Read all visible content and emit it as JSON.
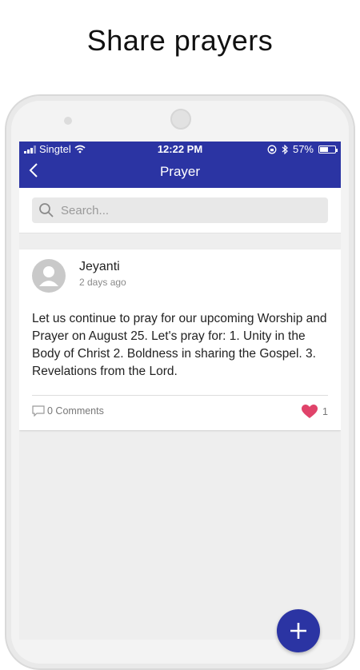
{
  "headline": "Share prayers",
  "status_bar": {
    "carrier": "Singtel",
    "time": "12:22 PM",
    "battery_percent": "57%",
    "battery_level": 0.57
  },
  "app_bar": {
    "title": "Prayer",
    "back_icon": "chevron-left-icon",
    "color": "#2b34a3"
  },
  "search": {
    "placeholder": "Search...",
    "value": ""
  },
  "post": {
    "author": "Jeyanti",
    "posted": "2 days ago",
    "body": "Let us continue to pray for our upcoming Worship and Prayer on August 25. Let's pray for: 1. Unity in the Body of Christ 2. Boldness in sharing the Gospel. 3. Revelations from the Lord.",
    "comments_label": "0 Comments",
    "likes_count": "1",
    "like_color": "#e0436a"
  },
  "fab": {
    "icon": "plus-icon"
  }
}
